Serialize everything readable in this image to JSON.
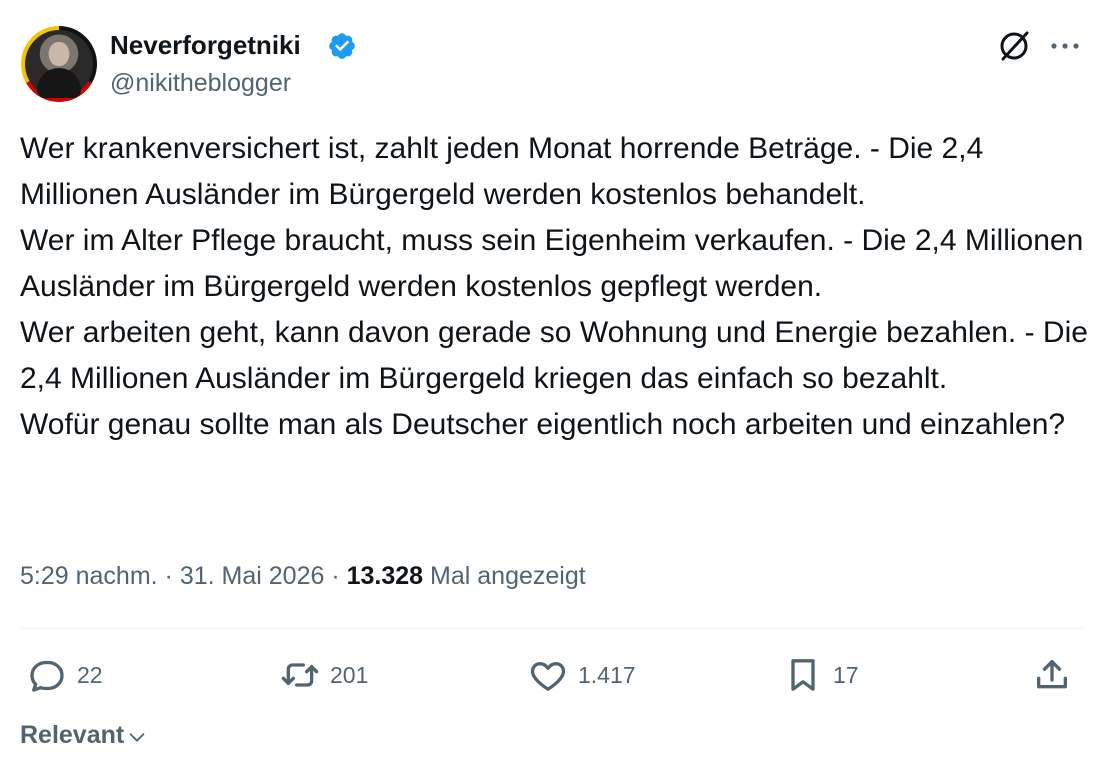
{
  "author": {
    "display_name": "Neverforgetniki",
    "handle": "@nikitheblogger",
    "verified": true
  },
  "tweet": {
    "text": "Wer krankenversichert ist, zahlt jeden Monat horrende Beträge. - Die 2,4 Millionen Ausländer im Bürgergeld werden kostenlos behandelt.\nWer im Alter Pflege braucht, muss sein Eigenheim verkaufen. - Die 2,4 Millionen Ausländer im Bürgergeld werden kostenlos gepflegt werden.\nWer arbeiten geht, kann davon gerade so Wohnung und Energie bezahlen. - Die 2,4 Millionen Ausländer im Bürgergeld kriegen das einfach so bezahlt.\nWofür genau sollte man als Deutscher eigentlich noch arbeiten und einzahlen?",
    "time": "5:29 nachm.",
    "date": "31. Mai 2026",
    "separator": "·",
    "views_count": "13.328",
    "views_label": "Mal angezeigt"
  },
  "actions": {
    "reply_count": "22",
    "retweet_count": "201",
    "like_count": "1.417",
    "bookmark_count": "17"
  },
  "sort": {
    "label": "Relevant"
  },
  "icons": {
    "verified": "verified-badge-icon",
    "grok": "grok-icon",
    "more": "more-icon",
    "reply": "reply-icon",
    "retweet": "retweet-icon",
    "like": "heart-icon",
    "bookmark": "bookmark-icon",
    "share": "share-icon",
    "sort": "chevron-down-icon"
  },
  "colors": {
    "verified_blue": "#1d9bf0",
    "text_primary": "#0f1419",
    "text_secondary": "#536471",
    "divider": "#eff3f4"
  }
}
